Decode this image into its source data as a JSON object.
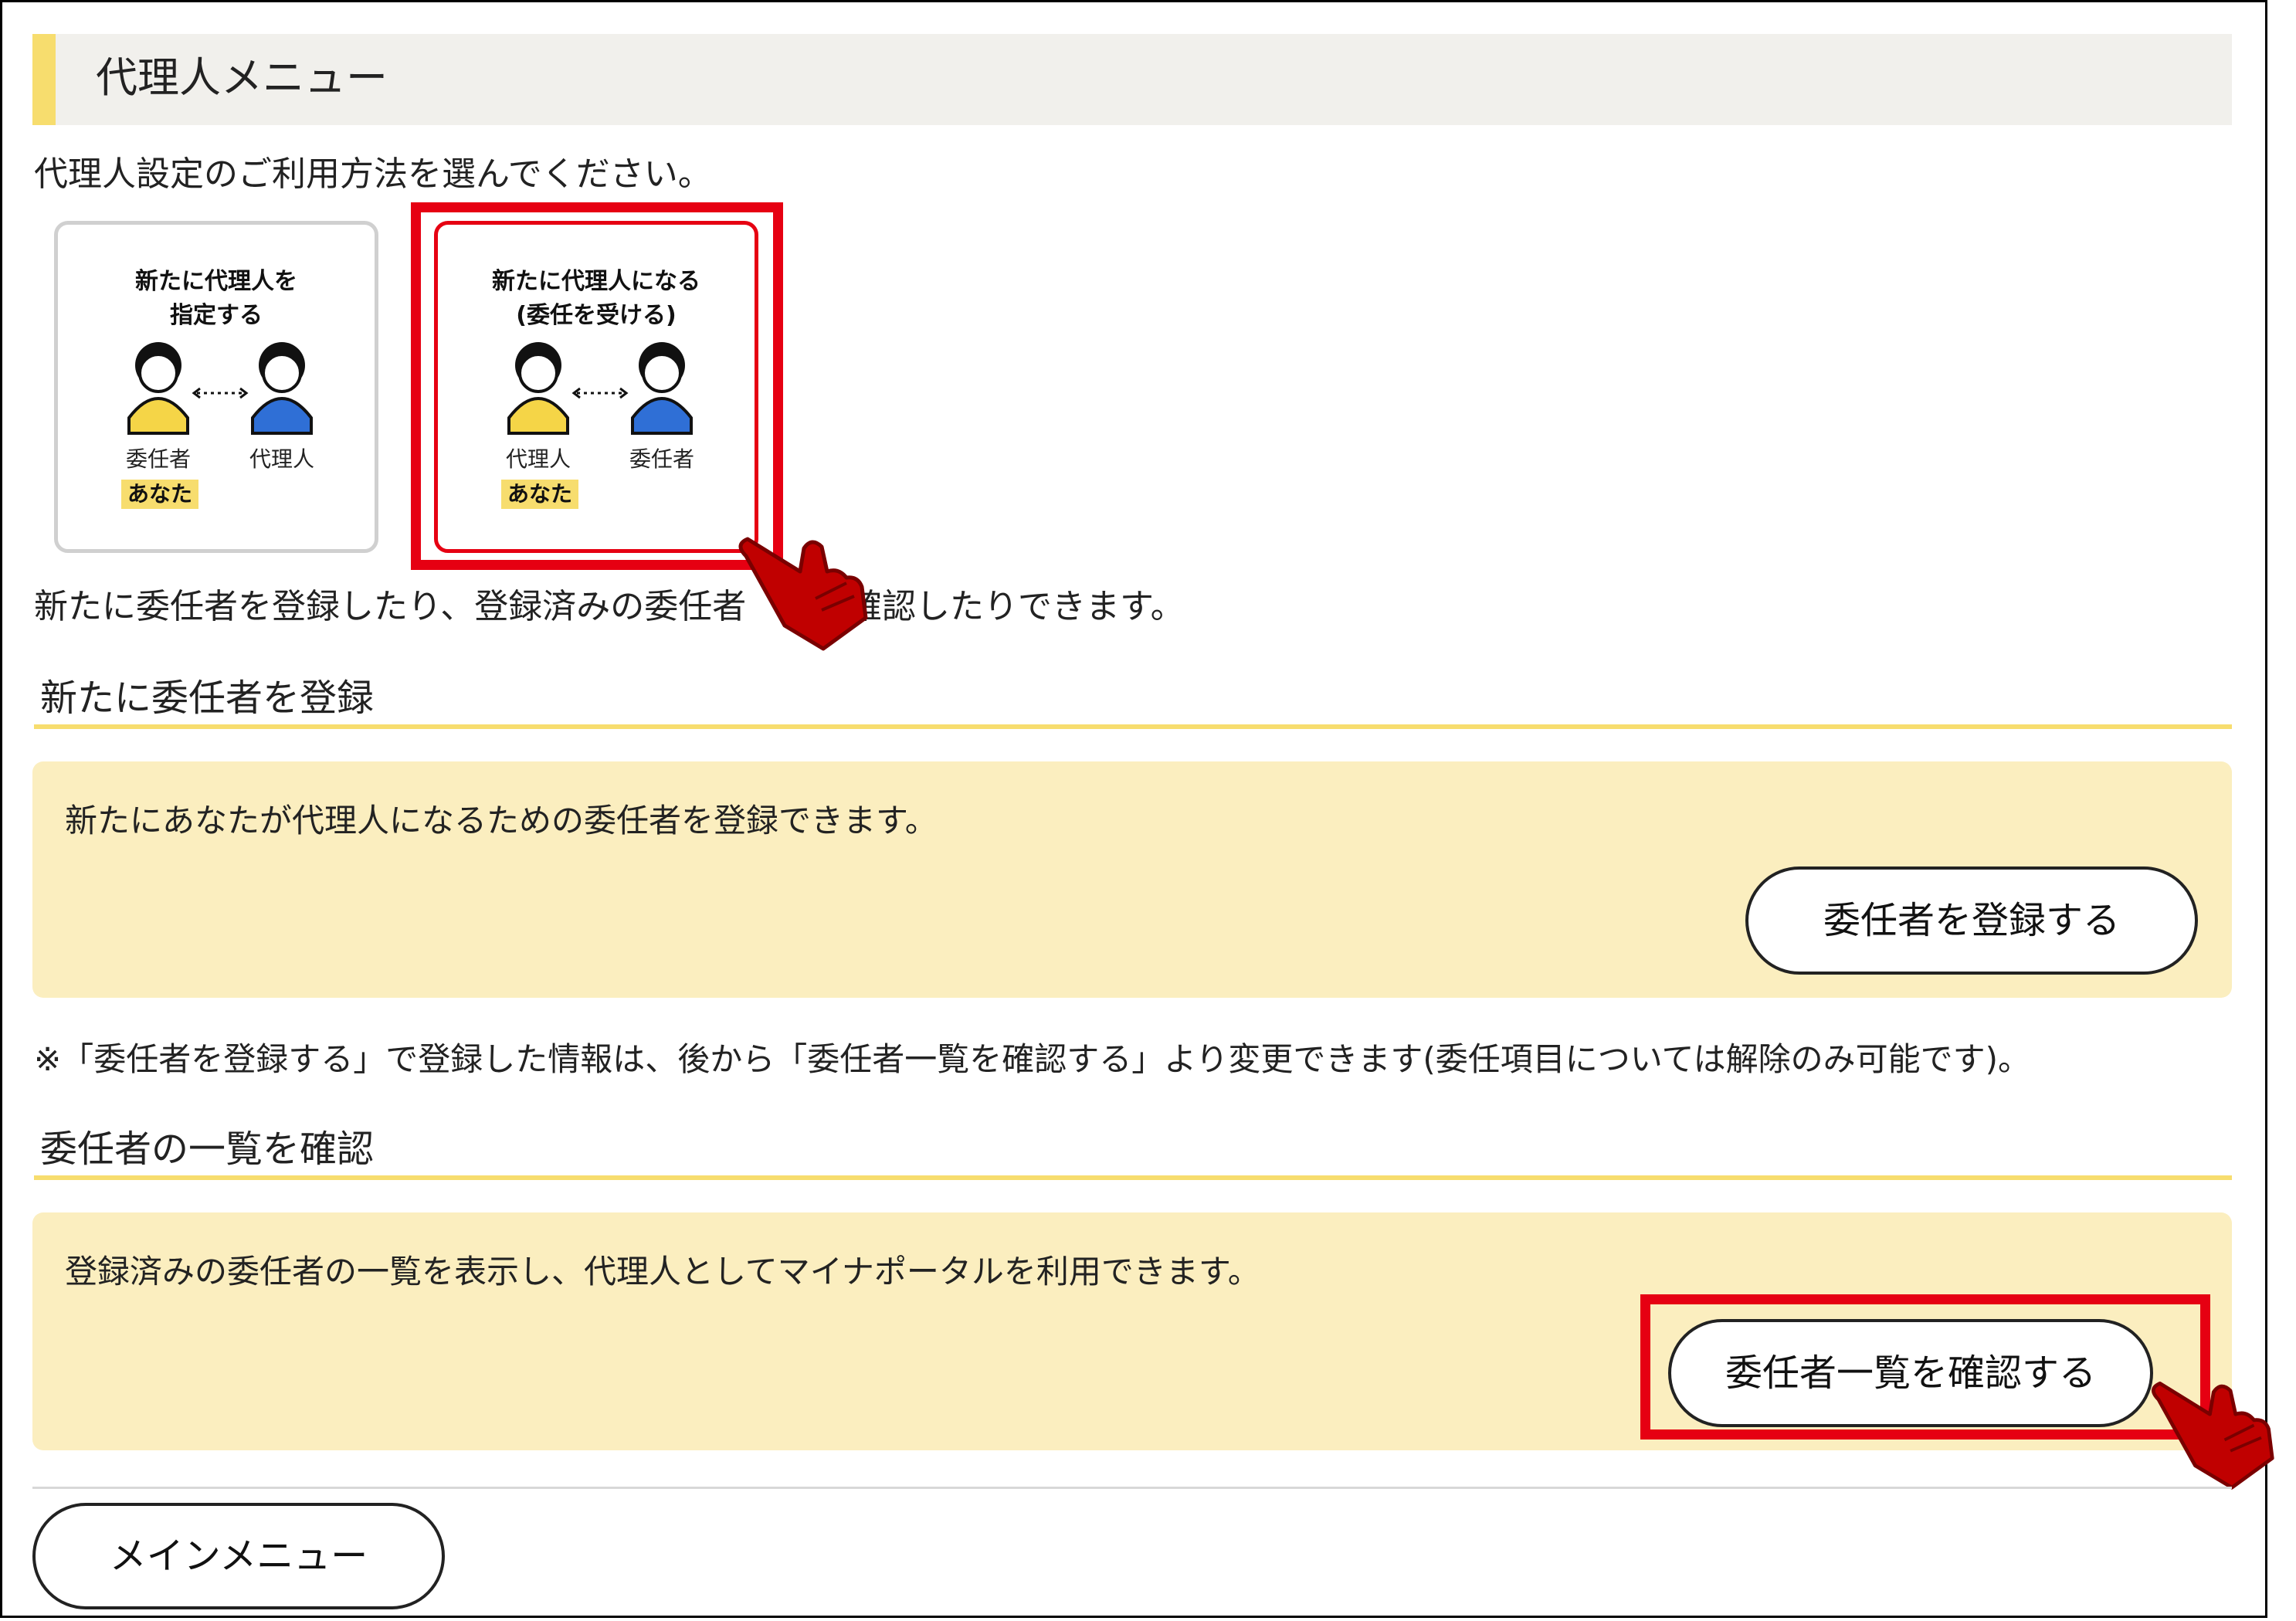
{
  "header": {
    "title": "代理人メニュー"
  },
  "intro_text": "代理人設定のご利用方法を選んでください。",
  "cards": [
    {
      "title_line1": "新たに代理人を",
      "title_line2": "指定する",
      "left_label": "委任者",
      "right_label": "代理人",
      "badge": "あなた"
    },
    {
      "title_line1": "新たに代理人になる",
      "title_line2": "(委任を受ける)",
      "left_label": "代理人",
      "right_label": "委任者",
      "badge": "あなた"
    }
  ],
  "description_left": "新たに委任者を登録したり、登録済みの委任者",
  "description_right": "確認したりできます。",
  "register_section": {
    "title": "新たに委任者を登録",
    "panel_text": "新たにあなたが代理人になるための委任者を登録できます。",
    "button": "委任者を登録する"
  },
  "note": "※「委任者を登録する」で登録した情報は、後から「委任者一覧を確認する」より変更できます(委任項目については解除のみ可能です)。",
  "list_section": {
    "title": "委任者の一覧を確認",
    "panel_text": "登録済みの委任者の一覧を表示し、代理人としてマイナポータルを利用できます。",
    "button": "委任者一覧を確認する"
  },
  "main_menu_button": "メインメニュー",
  "colors": {
    "accent_yellow": "#f7dd6e",
    "panel_bg": "#fbeebf",
    "highlight_red": "#e60012",
    "person_yellow": "#f5d547",
    "person_blue": "#2f6fd6"
  }
}
